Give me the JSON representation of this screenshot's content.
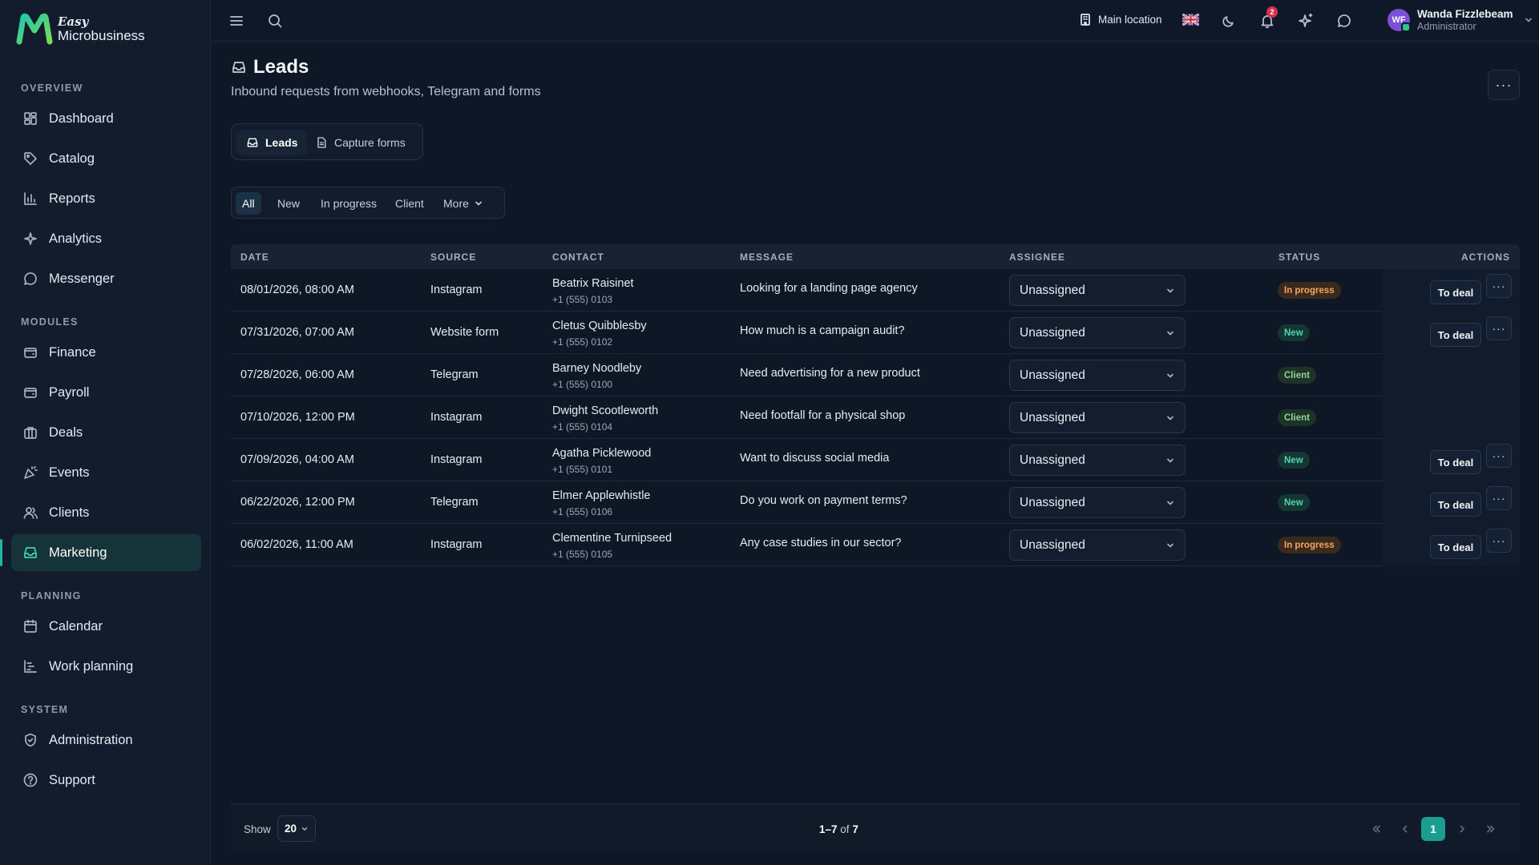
{
  "app": {
    "brand_top": "Easy",
    "brand_bottom": "Microbusiness"
  },
  "sidebar": {
    "sections": [
      {
        "title": "OVERVIEW"
      },
      {
        "title": "MODULES"
      },
      {
        "title": "PLANNING"
      },
      {
        "title": "SYSTEM"
      }
    ],
    "items": [
      {
        "label": "Dashboard",
        "icon": "dashboard-icon"
      },
      {
        "label": "Catalog",
        "icon": "tag-icon"
      },
      {
        "label": "Reports",
        "icon": "bar-chart-icon"
      },
      {
        "label": "Analytics",
        "icon": "sparkle-icon"
      },
      {
        "label": "Messenger",
        "icon": "chat-icon"
      },
      {
        "label": "Finance",
        "icon": "wallet-icon"
      },
      {
        "label": "Payroll",
        "icon": "wallet-icon"
      },
      {
        "label": "Deals",
        "icon": "briefcase-icon"
      },
      {
        "label": "Events",
        "icon": "party-icon"
      },
      {
        "label": "Clients",
        "icon": "users-icon"
      },
      {
        "label": "Marketing",
        "icon": "inbox-icon",
        "active": true
      },
      {
        "label": "Calendar",
        "icon": "calendar-icon"
      },
      {
        "label": "Work planning",
        "icon": "gantt-icon"
      },
      {
        "label": "Administration",
        "icon": "shield-icon"
      },
      {
        "label": "Support",
        "icon": "help-circle-icon"
      }
    ]
  },
  "topbar": {
    "location": "Main location",
    "notifications_count": "2",
    "user": {
      "initials": "WF",
      "name": "Wanda Fizzlebeam",
      "role": "Administrator"
    }
  },
  "page": {
    "title": "Leads",
    "subtitle": "Inbound requests from webhooks, Telegram and forms",
    "more_label": "···",
    "tabs": [
      {
        "label": "Leads",
        "active": true
      },
      {
        "label": "Capture forms",
        "active": false
      }
    ],
    "filters": [
      {
        "label": "All",
        "active": true
      },
      {
        "label": "New"
      },
      {
        "label": "In progress"
      },
      {
        "label": "Client"
      },
      {
        "label": "More"
      }
    ]
  },
  "table": {
    "columns": [
      "DATE",
      "SOURCE",
      "CONTACT",
      "MESSAGE",
      "ASSIGNEE",
      "STATUS",
      "ACTIONS"
    ],
    "deal_label": "To deal",
    "dots_label": "···",
    "rows": [
      {
        "date": "08/01/2026, 08:00 AM",
        "source": "Instagram",
        "name": "Beatrix Raisinet",
        "phone": "+1 (555) 0103",
        "message": "Looking for a landing page agency",
        "assignee": "Unassigned",
        "status": "In progress",
        "status_kind": "progress",
        "actions": true
      },
      {
        "date": "07/31/2026, 07:00 AM",
        "source": "Website form",
        "name": "Cletus Quibblesby",
        "phone": "+1 (555) 0102",
        "message": "How much is a campaign audit?",
        "assignee": "Unassigned",
        "status": "New",
        "status_kind": "new",
        "actions": true
      },
      {
        "date": "07/28/2026, 06:00 AM",
        "source": "Telegram",
        "name": "Barney Noodleby",
        "phone": "+1 (555) 0100",
        "message": "Need advertising for a new product",
        "assignee": "Unassigned",
        "status": "Client",
        "status_kind": "client",
        "actions": false
      },
      {
        "date": "07/10/2026, 12:00 PM",
        "source": "Instagram",
        "name": "Dwight Scootleworth",
        "phone": "+1 (555) 0104",
        "message": "Need footfall for a physical shop",
        "assignee": "Unassigned",
        "status": "Client",
        "status_kind": "client",
        "actions": false
      },
      {
        "date": "07/09/2026, 04:00 AM",
        "source": "Instagram",
        "name": "Agatha Picklewood",
        "phone": "+1 (555) 0101",
        "message": "Want to discuss social media",
        "assignee": "Unassigned",
        "status": "New",
        "status_kind": "new",
        "actions": true
      },
      {
        "date": "06/22/2026, 12:00 PM",
        "source": "Telegram",
        "name": "Elmer Applewhistle",
        "phone": "+1 (555) 0106",
        "message": "Do you work on payment terms?",
        "assignee": "Unassigned",
        "status": "New",
        "status_kind": "new",
        "actions": true
      },
      {
        "date": "06/02/2026, 11:00 AM",
        "source": "Instagram",
        "name": "Clementine Turnipseed",
        "phone": "+1 (555) 0105",
        "message": "Any case studies in our sector?",
        "assignee": "Unassigned",
        "status": "In progress",
        "status_kind": "progress",
        "actions": true
      }
    ]
  },
  "footer": {
    "show_label": "Show",
    "page_size": "20",
    "range": "1–7",
    "of_label": "of",
    "total": "7",
    "current_page": "1"
  },
  "colors": {
    "accent": "#1a9e91",
    "background": "#0e1726",
    "sidebar": "#121c2c"
  }
}
